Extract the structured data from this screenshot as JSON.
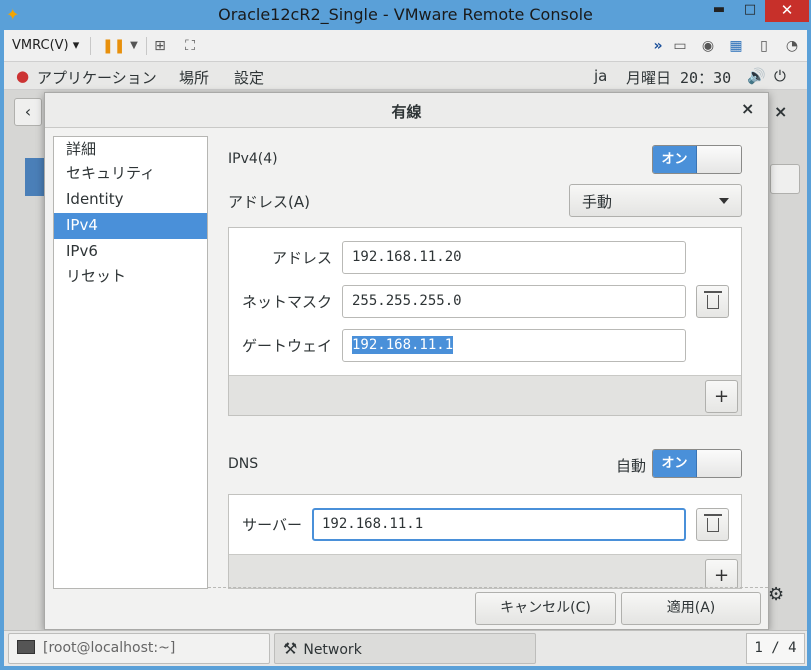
{
  "window": {
    "title": "Oracle12cR2_Single - VMware Remote Console",
    "minimize": "▬",
    "maximize": "□",
    "close": "✕"
  },
  "vmrc": {
    "menu_label": "VMRC(V) ▾"
  },
  "gnome_bar": {
    "applications": "アプリケーション",
    "places": "場所",
    "settings": "設定",
    "locale": "ja",
    "clock": "月曜日 20：30"
  },
  "dialog": {
    "title": "有線",
    "close": "×",
    "nav": [
      {
        "label": "詳細"
      },
      {
        "label": "セキュリティ"
      },
      {
        "label": "Identity"
      },
      {
        "label": "IPv4"
      },
      {
        "label": "IPv6"
      },
      {
        "label": "リセット"
      }
    ],
    "ipv4": {
      "heading": "IPv4(4)",
      "switch_label": "オン",
      "address_label": "アドレス(A)",
      "method": "手動",
      "rows": [
        {
          "label": "アドレス",
          "value": "192.168.11.20"
        },
        {
          "label": "ネットマスク",
          "value": "255.255.255.0"
        },
        {
          "label": "ゲートウェイ",
          "value": "192.168.11.1"
        }
      ],
      "add": "+"
    },
    "dns": {
      "heading": "DNS",
      "auto_label": "自動",
      "switch_label": "オン",
      "server_label": "サーバー",
      "server_value": "192.168.11.1",
      "add": "+"
    },
    "cancel": "キャンセル(C)",
    "apply": "適用(A)"
  },
  "taskbar": {
    "terminal": "[root@localhost:~]",
    "network": "Network",
    "pager": "1 / 4"
  },
  "colors": {
    "accent": "#4a90d9",
    "titlebar": "#5aa0d8",
    "close": "#c7302a"
  }
}
